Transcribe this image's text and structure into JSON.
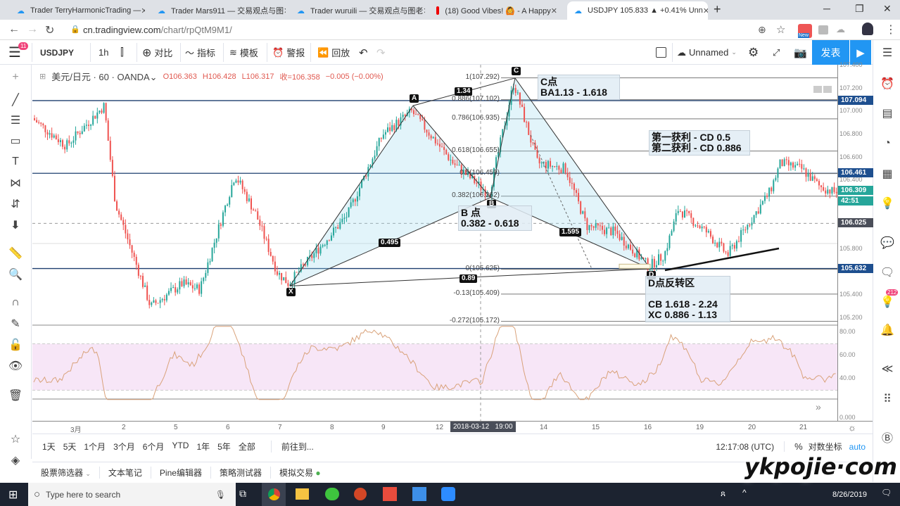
{
  "browser": {
    "tabs": [
      {
        "title": "Trader TerryHarmonicTrading —"
      },
      {
        "title": "Trader Mars911 — 交易观点与图"
      },
      {
        "title": "Trader wuruili — 交易观点与图老"
      },
      {
        "title": "(18) Good Vibes! 🙆 - A Happy"
      },
      {
        "title": "USDJPY 105.833 ▲ +0.41% Unn"
      }
    ],
    "url_host": "cn.tradingview.com",
    "url_path": "/chart/rpQtM9M1/",
    "ext_badge": "New"
  },
  "toolbar": {
    "menu_badge": "11",
    "symbol": "USDJPY",
    "interval": "1h",
    "compare": "对比",
    "indicators": "指标",
    "templates": "模板",
    "alert": "警报",
    "replay": "回放",
    "layout_name": "Unnamed",
    "publish": "发表"
  },
  "legend": {
    "symbol": "美元/日元",
    "interval": "60",
    "exchange": "OANDA",
    "open": "O106.363",
    "high": "H106.428",
    "low": "L106.317",
    "close": "收=106.358",
    "change": "−0.005 (−0.00%)"
  },
  "price_axis": {
    "ticks": [
      "107.400",
      "107.200",
      "107.000",
      "106.800",
      "106.600",
      "106.400",
      "105.800",
      "105.400",
      "105.200"
    ],
    "tick_values": [
      107.4,
      107.2,
      107.0,
      106.8,
      106.6,
      106.4,
      105.8,
      105.4,
      105.2
    ],
    "tags": [
      {
        "text": "107.094",
        "value": 107.094,
        "color": "#1e4f8f"
      },
      {
        "text": "106.461",
        "value": 106.461,
        "color": "#1e4f8f"
      },
      {
        "text": "106.309",
        "value": 106.309,
        "color": "#26a69a"
      },
      {
        "text": "42:51",
        "value": 106.22,
        "color": "#26a69a"
      },
      {
        "text": "106.025",
        "value": 106.025,
        "color": "#4a4e59"
      },
      {
        "text": "105.632",
        "value": 105.632,
        "color": "#1e4f8f"
      }
    ],
    "rsi_ticks": [
      "80.00",
      "60.00",
      "40.00",
      "0.000"
    ],
    "rsi_values": [
      80,
      60,
      40,
      0
    ]
  },
  "fib": [
    {
      "label": "1(107.292)",
      "value": 107.292
    },
    {
      "label": "0.886(107.102)",
      "value": 107.102
    },
    {
      "label": "0.786(106.935)",
      "value": 106.935
    },
    {
      "label": "0.618(106.655)",
      "value": 106.655
    },
    {
      "label": "0.5(106.459)",
      "value": 106.459
    },
    {
      "label": "0.382(106.262)",
      "value": 106.262
    },
    {
      "label": "0(105.625)",
      "value": 105.625
    },
    {
      "label": "-0.13(105.409)",
      "value": 105.409
    },
    {
      "label": "-0.272(105.172)",
      "value": 105.172
    }
  ],
  "pattern": {
    "points": [
      {
        "name": "X",
        "price": 105.48
      },
      {
        "name": "A",
        "price": 107.05
      },
      {
        "name": "B",
        "price": 106.25
      },
      {
        "name": "C",
        "price": 107.29
      },
      {
        "name": "D",
        "price": 105.63
      }
    ],
    "ratios": {
      "xb": "0.495",
      "ac": "1.34",
      "bd": "1.595",
      "xd": "0.89"
    }
  },
  "notes": {
    "c": "C点\nBA1.13 - 1.618",
    "b": "B 点\n0.382 - 0.618",
    "tp": "第一获利 - CD 0.5\n第二获利 - CD 0.886",
    "d": "D点反转区\n\nCB 1.618 - 2.24\nXC 0.886 - 1.13"
  },
  "time_axis": {
    "labels": [
      "3月",
      "2",
      "5",
      "6",
      "7",
      "8",
      "9",
      "12",
      "14",
      "15",
      "16",
      "19",
      "20",
      "21"
    ],
    "crosshair": "2018-03-12   19:00"
  },
  "range_bar": {
    "items": [
      "1天",
      "5天",
      "1个月",
      "3个月",
      "6个月",
      "YTD",
      "1年",
      "5年",
      "全部"
    ],
    "goto": "前往到...",
    "clock": "12:17:08 (UTC)",
    "percent": "%",
    "log": "对数坐标",
    "auto": "auto"
  },
  "bottom_tabs": [
    "股票筛选器",
    "文本笔记",
    "Pine编辑器",
    "策略测试器",
    "模拟交易"
  ],
  "right_badge": "212",
  "taskbar": {
    "search_placeholder": "Type here to search",
    "date": "8/26/2019"
  },
  "watermark": "ykpojie·com",
  "colors": {
    "up": "#26a69a",
    "down": "#ef5350",
    "accent": "#2196f3",
    "rsi": "#d9a27a"
  }
}
